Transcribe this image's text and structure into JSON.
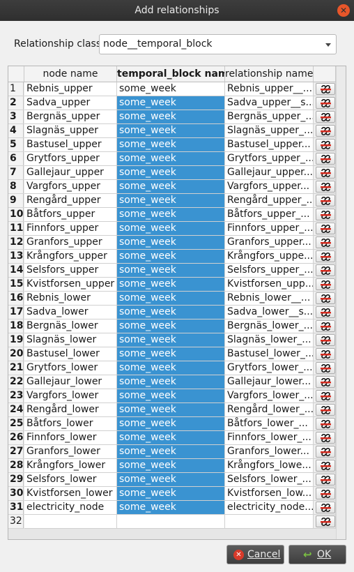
{
  "window": {
    "title": "Add relationships"
  },
  "relationship_class": {
    "label": "Relationship class",
    "value": "node__temporal_block"
  },
  "table": {
    "headers": [
      "node name",
      "temporal_block name",
      "relationship name"
    ],
    "rows": [
      {
        "num": "1",
        "node": "Rebnis_upper",
        "block": "some_week",
        "rel": "Rebnis_upper__..."
      },
      {
        "num": "2",
        "node": "Sadva_upper",
        "block": "some_week",
        "rel": "Sadva_upper__s..."
      },
      {
        "num": "3",
        "node": "Bergnäs_upper",
        "block": "some_week",
        "rel": "Bergnäs_upper_..."
      },
      {
        "num": "4",
        "node": "Slagnäs_upper",
        "block": "some_week",
        "rel": "Slagnäs_upper_..."
      },
      {
        "num": "5",
        "node": "Bastusel_upper",
        "block": "some_week",
        "rel": "Bastusel_upper..."
      },
      {
        "num": "6",
        "node": "Grytfors_upper",
        "block": "some_week",
        "rel": "Grytfors_upper_..."
      },
      {
        "num": "7",
        "node": "Gallejaur_upper",
        "block": "some_week",
        "rel": "Gallejaur_upper..."
      },
      {
        "num": "8",
        "node": "Vargfors_upper",
        "block": "some_week",
        "rel": "Vargfors_upper..."
      },
      {
        "num": "9",
        "node": "Rengård_upper",
        "block": "some_week",
        "rel": "Rengård_upper_..."
      },
      {
        "num": "10",
        "node": "Båtfors_upper",
        "block": "some_week",
        "rel": "Båtfors_upper_..."
      },
      {
        "num": "11",
        "node": "Finnfors_upper",
        "block": "some_week",
        "rel": "Finnfors_upper_..."
      },
      {
        "num": "12",
        "node": "Granfors_upper",
        "block": "some_week",
        "rel": "Granfors_upper..."
      },
      {
        "num": "13",
        "node": "Krångfors_upper",
        "block": "some_week",
        "rel": "Krångfors_uppe..."
      },
      {
        "num": "14",
        "node": "Selsfors_upper",
        "block": "some_week",
        "rel": "Selsfors_upper_..."
      },
      {
        "num": "15",
        "node": "Kvistforsen_upper",
        "block": "some_week",
        "rel": "Kvistforsen_upp..."
      },
      {
        "num": "16",
        "node": "Rebnis_lower",
        "block": "some_week",
        "rel": "Rebnis_lower__..."
      },
      {
        "num": "17",
        "node": "Sadva_lower",
        "block": "some_week",
        "rel": "Sadva_lower__s..."
      },
      {
        "num": "18",
        "node": "Bergnäs_lower",
        "block": "some_week",
        "rel": "Bergnäs_lower_..."
      },
      {
        "num": "19",
        "node": "Slagnäs_lower",
        "block": "some_week",
        "rel": "Slagnäs_lower_..."
      },
      {
        "num": "20",
        "node": "Bastusel_lower",
        "block": "some_week",
        "rel": "Bastusel_lower_..."
      },
      {
        "num": "21",
        "node": "Grytfors_lower",
        "block": "some_week",
        "rel": "Grytfors_lower_..."
      },
      {
        "num": "22",
        "node": "Gallejaur_lower",
        "block": "some_week",
        "rel": "Gallejaur_lower..."
      },
      {
        "num": "23",
        "node": "Vargfors_lower",
        "block": "some_week",
        "rel": "Vargfors_lower_..."
      },
      {
        "num": "24",
        "node": "Rengård_lower",
        "block": "some_week",
        "rel": "Rengård_lower_..."
      },
      {
        "num": "25",
        "node": "Båtfors_lower",
        "block": "some_week",
        "rel": "Båtfors_lower_..."
      },
      {
        "num": "26",
        "node": "Finnfors_lower",
        "block": "some_week",
        "rel": "Finnfors_lower_..."
      },
      {
        "num": "27",
        "node": "Granfors_lower",
        "block": "some_week",
        "rel": "Granfors_lower..."
      },
      {
        "num": "28",
        "node": "Krångfors_lower",
        "block": "some_week",
        "rel": "Krångfors_lowe..."
      },
      {
        "num": "29",
        "node": "Selsfors_lower",
        "block": "some_week",
        "rel": "Selsfors_lower_..."
      },
      {
        "num": "30",
        "node": "Kvistforsen_lower",
        "block": "some_week",
        "rel": "Kvistforsen_low..."
      },
      {
        "num": "31",
        "node": "electricity_node",
        "block": "some_week",
        "rel": "electricity_node..."
      },
      {
        "num": "32",
        "node": "",
        "block": "",
        "rel": ""
      }
    ]
  },
  "buttons": {
    "cancel": "Cancel",
    "ok": "OK"
  },
  "colors": {
    "selection": "#3a93d1",
    "titlebar": "#2f2f2f",
    "close": "#e8562a"
  },
  "icons": {
    "close": "close-icon",
    "edit": "edit-relationship-icon",
    "cancel": "cancel-icon",
    "ok": "checkmark-icon"
  }
}
